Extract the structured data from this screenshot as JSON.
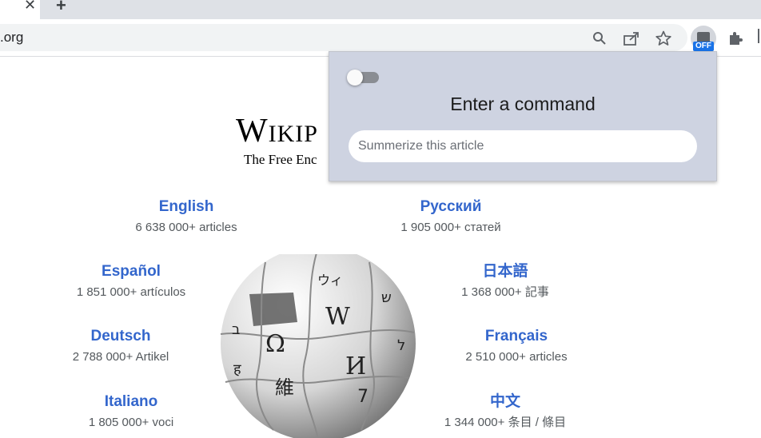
{
  "browser": {
    "tab_close": "✕",
    "new_tab": "+",
    "url_fragment": ".org",
    "extension_badge": "OFF"
  },
  "wikipedia": {
    "title_first": "W",
    "title_rest": "IKIP",
    "tagline": "The Free Enc",
    "languages": [
      {
        "name": "English",
        "count": "6 638 000+ articles"
      },
      {
        "name": "Русский",
        "count": "1 905 000+ статей"
      },
      {
        "name": "Español",
        "count": "1 851 000+ artículos"
      },
      {
        "name": "日本語",
        "count": "1 368 000+ 記事"
      },
      {
        "name": "Deutsch",
        "count": "2 788 000+ Artikel"
      },
      {
        "name": "Français",
        "count": "2 510 000+ articles"
      },
      {
        "name": "Italiano",
        "count": "1 805 000+ voci"
      },
      {
        "name": "中文",
        "count": "1 344 000+ 条目 / 條目"
      }
    ],
    "globe_glyphs": [
      "Ω",
      "W",
      "И",
      "維",
      "ウィ",
      "ש",
      "ל",
      "ב",
      "ह",
      "7"
    ]
  },
  "popup": {
    "title": "Enter a command",
    "input_placeholder": "Summerize this article",
    "toggle_state": "off"
  },
  "colors": {
    "link": "#3366cc",
    "popup_bg": "#ced3e1",
    "badge": "#1a73e8"
  }
}
